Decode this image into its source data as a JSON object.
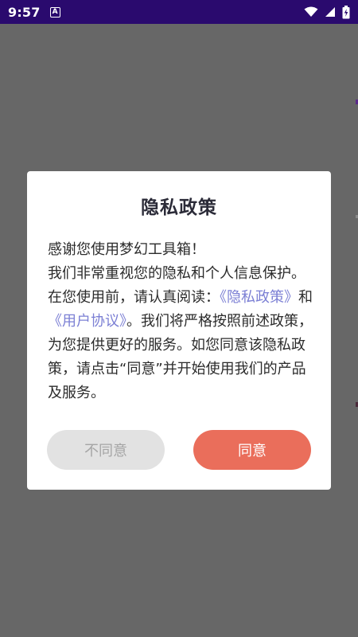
{
  "status_bar": {
    "time": "9:57",
    "notification_icon": "A",
    "icons": [
      "wifi-icon",
      "signal-icon",
      "battery-charging-icon"
    ]
  },
  "dialog": {
    "title": "隐私政策",
    "line1": "感谢您使用梦幻工具箱！",
    "text_part1": "我们非常重视您的隐私和个人信息保护。在您使用前，请认真阅读：",
    "link_privacy": "《隐私政策》",
    "text_and": "和",
    "link_agreement": "《用户协议》",
    "text_part2": "。我们将严格按照前述政策，为您提供更好的服务。如您同意该隐私政策，请点击“同意”并开始使用我们的产品及服务。",
    "disagree_label": "不同意",
    "agree_label": "同意"
  },
  "colors": {
    "status_bar": "#2a0a6e",
    "backdrop": "#676767",
    "link": "#7b7fd4",
    "agree_button": "#ea6e5b",
    "disagree_button": "#e2e2e2"
  }
}
